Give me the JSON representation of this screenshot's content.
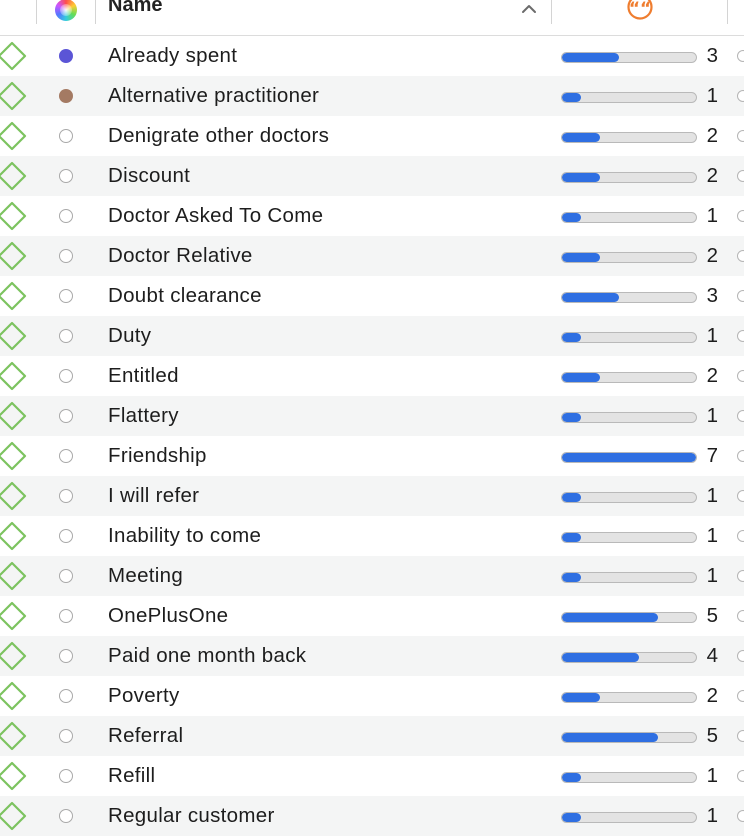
{
  "header": {
    "color_column_icon": "color-wheel-icon",
    "name_label": "Name",
    "sort_icon": "chevron-up-icon",
    "quotations_icon": "quote-bubble-icon"
  },
  "colors": {
    "code_icon": "#7cc35f",
    "bar_fill": "#2f6fe2",
    "bar_track": "#e3e3e3",
    "orange_icon": "#ef7d2f"
  },
  "max_count": 7,
  "rows": [
    {
      "name": "Already spent",
      "count": "3",
      "color": "#5b55d6"
    },
    {
      "name": "Alternative practitioner",
      "count": "1",
      "color": "#a47a63"
    },
    {
      "name": "Denigrate other doctors",
      "count": "2",
      "color": ""
    },
    {
      "name": "Discount",
      "count": "2",
      "color": ""
    },
    {
      "name": "Doctor Asked To Come",
      "count": "1",
      "color": ""
    },
    {
      "name": "Doctor Relative",
      "count": "2",
      "color": ""
    },
    {
      "name": "Doubt clearance",
      "count": "3",
      "color": ""
    },
    {
      "name": "Duty",
      "count": "1",
      "color": ""
    },
    {
      "name": "Entitled",
      "count": "2",
      "color": ""
    },
    {
      "name": "Flattery",
      "count": "1",
      "color": ""
    },
    {
      "name": "Friendship",
      "count": "7",
      "color": ""
    },
    {
      "name": "I will refer",
      "count": "1",
      "color": ""
    },
    {
      "name": "Inability to come",
      "count": "1",
      "color": ""
    },
    {
      "name": "Meeting",
      "count": "1",
      "color": ""
    },
    {
      "name": "OnePlusOne",
      "count": "5",
      "color": ""
    },
    {
      "name": "Paid one month back",
      "count": "4",
      "color": ""
    },
    {
      "name": "Poverty",
      "count": "2",
      "color": ""
    },
    {
      "name": "Referral",
      "count": "5",
      "color": ""
    },
    {
      "name": "Refill",
      "count": "1",
      "color": ""
    },
    {
      "name": "Regular customer",
      "count": "1",
      "color": ""
    }
  ]
}
